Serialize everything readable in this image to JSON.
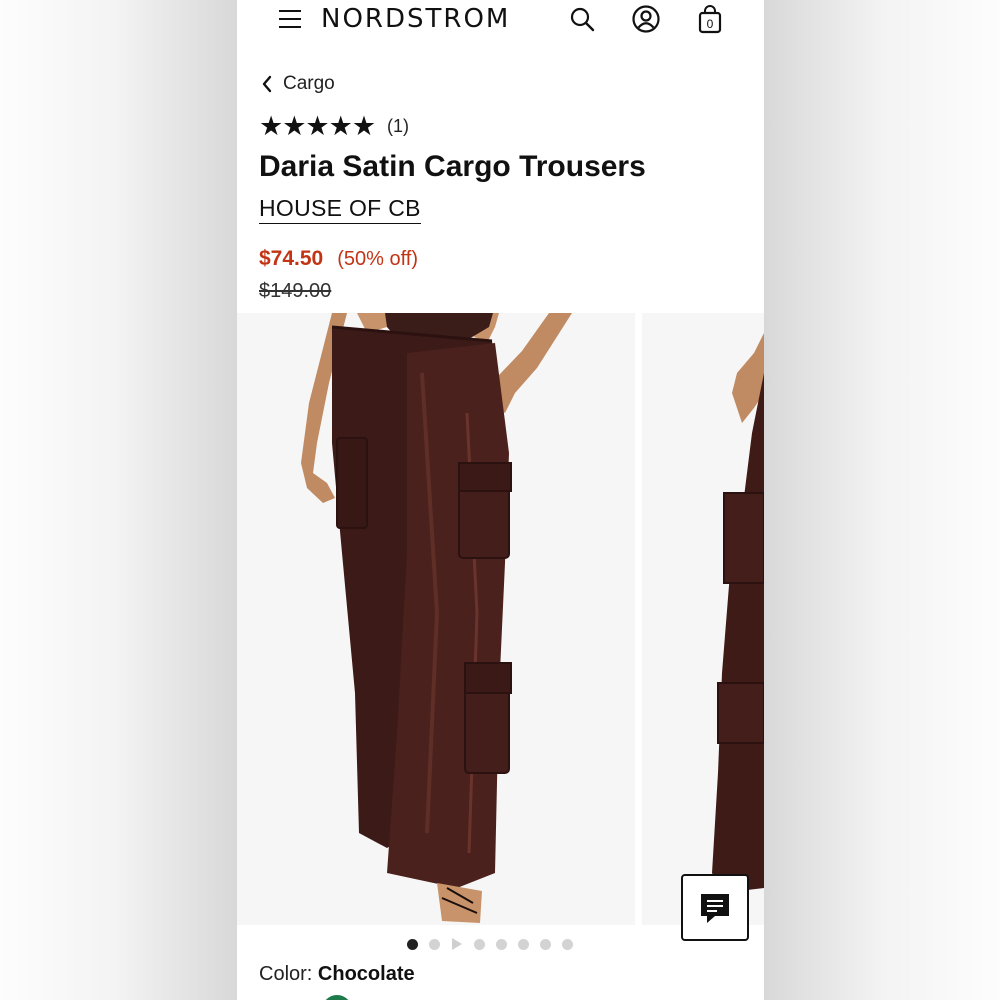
{
  "header": {
    "logo": "NORDSTROM",
    "bag_count": "0",
    "icons": [
      "menu-icon",
      "search-icon",
      "account-icon",
      "bag-icon"
    ]
  },
  "breadcrumb": {
    "label": "Cargo"
  },
  "product": {
    "rating_stars": "★★★★★",
    "rating_value": 5,
    "review_count": "(1)",
    "title": "Daria Satin Cargo Trousers",
    "brand": "HOUSE OF CB",
    "sale_price": "$74.50",
    "discount": "(50% off)",
    "original_price": "$149.00"
  },
  "gallery": {
    "dot_count": 8,
    "active_index": 0,
    "video_index": 2
  },
  "color": {
    "label": "Color:",
    "value": "Chocolate"
  },
  "colors": {
    "sale": "#c23414",
    "product": "#3a1a16",
    "swatch": "#1e7a4a"
  }
}
